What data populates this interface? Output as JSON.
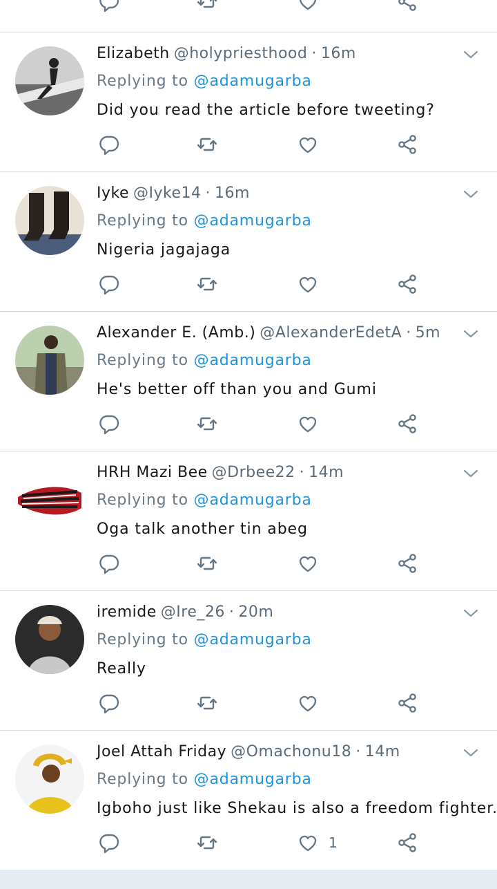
{
  "replying_prefix": "Replying to",
  "tweets": [
    {
      "name": "Elizabeth",
      "handle": "@holypriesthood",
      "time": "16m",
      "mention": "@adamugarba",
      "text": "Did you read the article before tweeting?",
      "like_count": ""
    },
    {
      "name": "Iyke",
      "handle": "@Iyke14",
      "time": "16m",
      "mention": "@adamugarba",
      "text": "Nigeria jagajaga",
      "like_count": ""
    },
    {
      "name": "Alexander E. (Amb.)",
      "handle": "@AlexanderEdetA",
      "time": "5m",
      "mention": "@adamugarba",
      "text": "He's better off than you and Gumi",
      "like_count": ""
    },
    {
      "name": "HRH Mazi Bee",
      "handle": "@Drbee22",
      "time": "14m",
      "mention": "@adamugarba",
      "text": "Oga talk another tin abeg",
      "like_count": ""
    },
    {
      "name": "iremide",
      "handle": "@Ire_26",
      "time": "20m",
      "mention": "@adamugarba",
      "text": "Really",
      "like_count": ""
    },
    {
      "name": "Joel Attah Friday",
      "handle": "@Omachonu18",
      "time": "14m",
      "mention": "@adamugarba",
      "text": "Igboho just like Shekau is also a freedom fighter.",
      "like_count": "1"
    }
  ],
  "icons": {
    "reply": "reply-icon",
    "retweet": "retweet-icon",
    "like": "heart-icon",
    "share": "share-icon",
    "menu": "chevron-down-icon"
  },
  "colors": {
    "link": "#1b95e0",
    "muted": "#5b6b78",
    "divider": "#d8dde1"
  }
}
